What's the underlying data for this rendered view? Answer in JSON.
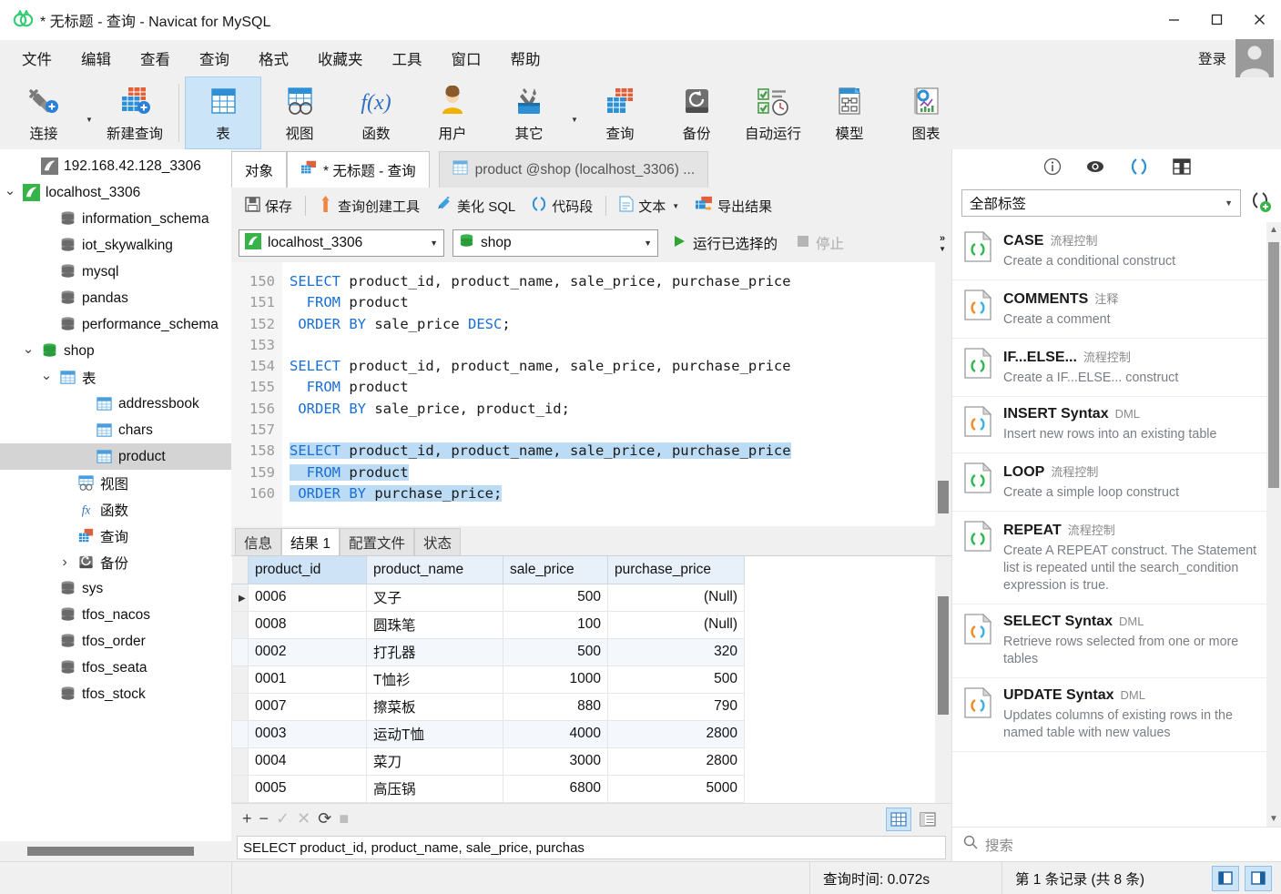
{
  "window": {
    "title": "* 无标题 - 查询 - Navicat for MySQL",
    "minimize": "—",
    "maximize": "□",
    "close": "✕"
  },
  "menubar": {
    "items": [
      "文件",
      "编辑",
      "查看",
      "查询",
      "格式",
      "收藏夹",
      "工具",
      "窗口",
      "帮助"
    ],
    "login_label": "登录"
  },
  "toolbar": {
    "items": [
      {
        "label": "连接",
        "icon": "connection-icon",
        "has_caret": true,
        "active": false
      },
      {
        "label": "新建查询",
        "icon": "new-query-icon",
        "has_caret": false,
        "active": false
      },
      {
        "label": "表",
        "icon": "table-icon",
        "has_caret": false,
        "active": true
      },
      {
        "label": "视图",
        "icon": "view-icon",
        "has_caret": false,
        "active": false
      },
      {
        "label": "函数",
        "icon": "function-icon",
        "has_caret": false,
        "active": false
      },
      {
        "label": "用户",
        "icon": "user-icon",
        "has_caret": false,
        "active": false
      },
      {
        "label": "其它",
        "icon": "other-tools-icon",
        "has_caret": true,
        "active": false
      },
      {
        "label": "查询",
        "icon": "query-icon",
        "has_caret": false,
        "active": false
      },
      {
        "label": "备份",
        "icon": "backup-icon",
        "has_caret": false,
        "active": false
      },
      {
        "label": "自动运行",
        "icon": "automation-icon",
        "has_caret": false,
        "active": false
      },
      {
        "label": "模型",
        "icon": "model-icon",
        "has_caret": false,
        "active": false
      },
      {
        "label": "图表",
        "icon": "chart-icon",
        "has_caret": false,
        "active": false
      }
    ]
  },
  "sidebar": {
    "items": [
      {
        "label": "192.168.42.128_3306",
        "indent": 1,
        "icon": "connection-gray-icon",
        "twisty": "",
        "selected": false
      },
      {
        "label": "localhost_3306",
        "indent": 0,
        "icon": "connection-green-icon",
        "twisty": "v",
        "selected": false
      },
      {
        "label": "information_schema",
        "indent": 2,
        "icon": "database-gray-icon",
        "twisty": "",
        "selected": false
      },
      {
        "label": "iot_skywalking",
        "indent": 2,
        "icon": "database-gray-icon",
        "twisty": "",
        "selected": false
      },
      {
        "label": "mysql",
        "indent": 2,
        "icon": "database-gray-icon",
        "twisty": "",
        "selected": false
      },
      {
        "label": "pandas",
        "indent": 2,
        "icon": "database-gray-icon",
        "twisty": "",
        "selected": false
      },
      {
        "label": "performance_schema",
        "indent": 2,
        "icon": "database-gray-icon",
        "twisty": "",
        "selected": false
      },
      {
        "label": "shop",
        "indent": 1,
        "icon": "database-green-icon",
        "twisty": "v",
        "selected": false
      },
      {
        "label": "表",
        "indent": 2,
        "icon": "table-folder-icon",
        "twisty": "v",
        "selected": false
      },
      {
        "label": "addressbook",
        "indent": 4,
        "icon": "table-blue-icon",
        "twisty": "",
        "selected": false
      },
      {
        "label": "chars",
        "indent": 4,
        "icon": "table-blue-icon",
        "twisty": "",
        "selected": false
      },
      {
        "label": "product",
        "indent": 4,
        "icon": "table-blue-icon",
        "twisty": "",
        "selected": true
      },
      {
        "label": "视图",
        "indent": 3,
        "icon": "view-folder-icon",
        "twisty": "",
        "selected": false
      },
      {
        "label": "函数",
        "indent": 3,
        "icon": "function-folder-icon",
        "twisty": "",
        "selected": false
      },
      {
        "label": "查询",
        "indent": 3,
        "icon": "query-folder-icon",
        "twisty": "",
        "selected": false
      },
      {
        "label": "备份",
        "indent": 3,
        "icon": "backup-folder-icon",
        "twisty": ">",
        "selected": false
      },
      {
        "label": "sys",
        "indent": 2,
        "icon": "database-gray-icon",
        "twisty": "",
        "selected": false
      },
      {
        "label": "tfos_nacos",
        "indent": 2,
        "icon": "database-gray-icon",
        "twisty": "",
        "selected": false
      },
      {
        "label": "tfos_order",
        "indent": 2,
        "icon": "database-gray-icon",
        "twisty": "",
        "selected": false
      },
      {
        "label": "tfos_seata",
        "indent": 2,
        "icon": "database-gray-icon",
        "twisty": "",
        "selected": false
      },
      {
        "label": "tfos_stock",
        "indent": 2,
        "icon": "database-gray-icon",
        "twisty": "",
        "selected": false
      }
    ]
  },
  "tabs": [
    {
      "label": "对象",
      "active": false,
      "icon": ""
    },
    {
      "label": "* 无标题 - 查询",
      "active": true,
      "icon": "query-icon"
    },
    {
      "label": "product @shop (localhost_3306) ...",
      "active": false,
      "icon": "table-blue-icon"
    }
  ],
  "query_toolbar": {
    "save": "保存",
    "query_builder": "查询创建工具",
    "beautify_sql": "美化 SQL",
    "code_snippet": "代码段",
    "text": "文本",
    "export_result": "导出结果"
  },
  "connbar": {
    "connection": "localhost_3306",
    "database": "shop",
    "run_selected": "运行已选择的",
    "stop": "停止"
  },
  "editor": {
    "first_line_number": 150,
    "lines": [
      {
        "n": 150,
        "segments": [
          {
            "t": "SELECT",
            "k": true
          },
          {
            "t": " product_id, product_name, sale_price, purchase_price",
            "k": false
          }
        ],
        "selected": false
      },
      {
        "n": 151,
        "segments": [
          {
            "t": "  FROM",
            "k": true
          },
          {
            "t": " product",
            "k": false
          }
        ],
        "selected": false
      },
      {
        "n": 152,
        "segments": [
          {
            "t": " ORDER BY",
            "k": true
          },
          {
            "t": " sale_price ",
            "k": false
          },
          {
            "t": "DESC",
            "k": true
          },
          {
            "t": ";",
            "k": false
          }
        ],
        "selected": false
      },
      {
        "n": 153,
        "segments": [],
        "selected": false
      },
      {
        "n": 154,
        "segments": [
          {
            "t": "SELECT",
            "k": true
          },
          {
            "t": " product_id, product_name, sale_price, purchase_price",
            "k": false
          }
        ],
        "selected": false
      },
      {
        "n": 155,
        "segments": [
          {
            "t": "  FROM",
            "k": true
          },
          {
            "t": " product",
            "k": false
          }
        ],
        "selected": false
      },
      {
        "n": 156,
        "segments": [
          {
            "t": " ORDER BY",
            "k": true
          },
          {
            "t": " sale_price, product_id;",
            "k": false
          }
        ],
        "selected": false
      },
      {
        "n": 157,
        "segments": [],
        "selected": false
      },
      {
        "n": 158,
        "segments": [
          {
            "t": "SELECT",
            "k": true
          },
          {
            "t": " product_id, product_name, sale_price, purchase_price",
            "k": false
          }
        ],
        "selected": true
      },
      {
        "n": 159,
        "segments": [
          {
            "t": "  FROM",
            "k": true
          },
          {
            "t": " product",
            "k": false
          }
        ],
        "selected": true
      },
      {
        "n": 160,
        "segments": [
          {
            "t": " ORDER BY",
            "k": true
          },
          {
            "t": " purchase_price;",
            "k": false
          }
        ],
        "selected": true
      }
    ]
  },
  "result": {
    "tabs": [
      {
        "label": "信息",
        "active": false
      },
      {
        "label": "结果 1",
        "active": true
      },
      {
        "label": "配置文件",
        "active": false
      },
      {
        "label": "状态",
        "active": false
      }
    ],
    "columns": [
      "product_id",
      "product_name",
      "sale_price",
      "purchase_price"
    ],
    "sorted_column": "product_id",
    "rows": [
      {
        "product_id": "0006",
        "product_name": "叉子",
        "sale_price": "500",
        "purchase_price": "(Null)",
        "current": true
      },
      {
        "product_id": "0008",
        "product_name": "圆珠笔",
        "sale_price": "100",
        "purchase_price": "(Null)",
        "current": false
      },
      {
        "product_id": "0002",
        "product_name": "打孔器",
        "sale_price": "500",
        "purchase_price": "320",
        "current": false
      },
      {
        "product_id": "0001",
        "product_name": "T恤衫",
        "sale_price": "1000",
        "purchase_price": "500",
        "current": false
      },
      {
        "product_id": "0007",
        "product_name": "擦菜板",
        "sale_price": "880",
        "purchase_price": "790",
        "current": false
      },
      {
        "product_id": "0003",
        "product_name": "运动T恤",
        "sale_price": "4000",
        "purchase_price": "2800",
        "current": false
      },
      {
        "product_id": "0004",
        "product_name": "菜刀",
        "sale_price": "3000",
        "purchase_price": "2800",
        "current": false
      },
      {
        "product_id": "0005",
        "product_name": "高压锅",
        "sale_price": "6800",
        "purchase_price": "5000",
        "current": false
      }
    ],
    "sql_preview": "SELECT product_id, product_name, sale_price, purchas",
    "grid_actions": [
      "+",
      "−",
      "✓",
      "✕",
      "⟳",
      "■"
    ]
  },
  "rightpanel": {
    "icons": [
      "info-icon",
      "preview-eye-icon",
      "code-snippet-icon",
      "grid-icon"
    ],
    "filter_label": "全部标签",
    "add_snippet": "add-snippet-icon",
    "search_placeholder": "搜索",
    "snippets": [
      {
        "title": "CASE",
        "tag": "流程控制",
        "desc": "Create a conditional construct",
        "color": "green"
      },
      {
        "title": "COMMENTS",
        "tag": "注释",
        "desc": "Create a comment",
        "color": "orange"
      },
      {
        "title": "IF...ELSE...",
        "tag": "流程控制",
        "desc": "Create a IF...ELSE... construct",
        "color": "green"
      },
      {
        "title": "INSERT Syntax",
        "tag": "DML",
        "desc": "Insert new rows into an existing table",
        "color": "orange"
      },
      {
        "title": "LOOP",
        "tag": "流程控制",
        "desc": "Create a simple loop construct",
        "color": "green"
      },
      {
        "title": "REPEAT",
        "tag": "流程控制",
        "desc": "Create A REPEAT construct. The Statement list is repeated until the search_condition expression is true.",
        "color": "green"
      },
      {
        "title": "SELECT Syntax",
        "tag": "DML",
        "desc": "Retrieve rows selected from one or more tables",
        "color": "orange"
      },
      {
        "title": "UPDATE Syntax",
        "tag": "DML",
        "desc": "Updates columns of existing rows in the named table with new values",
        "color": "orange"
      }
    ]
  },
  "statusbar": {
    "query_time": "查询时间: 0.072s",
    "record_info": "第 1 条记录 (共 8 条)"
  },
  "colors": {
    "accent_blue": "#1a6fd4",
    "selection_blue": "#bcdcf5",
    "toolbar_active": "#cce4f7",
    "green": "#00a651",
    "orange": "#f68b1f"
  }
}
